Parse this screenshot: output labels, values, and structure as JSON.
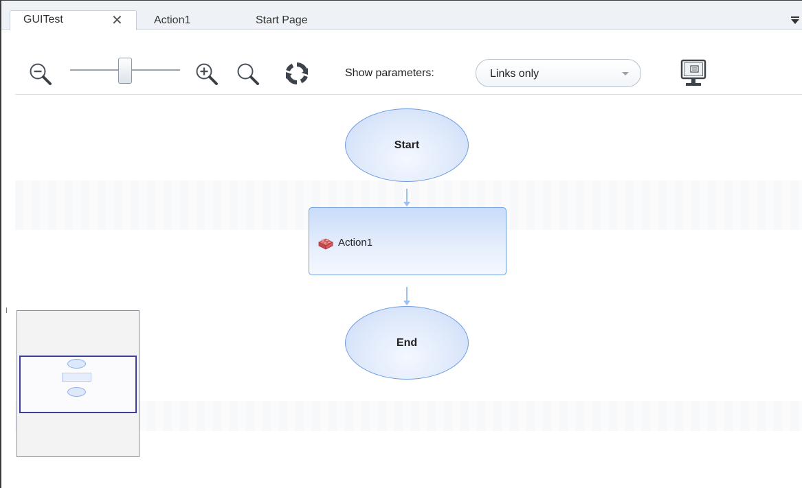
{
  "tabs": [
    {
      "label": "GUITest",
      "active": true,
      "closable": true
    },
    {
      "label": "Action1",
      "active": false
    },
    {
      "label": "Start Page",
      "active": false
    }
  ],
  "tab_close_glyph": "✕",
  "toolbar": {
    "show_parameters_label": "Show parameters:",
    "show_parameters_value": "Links only",
    "zoom_level": 0.45,
    "icons": [
      "zoom-out-icon",
      "zoom-in-icon",
      "zoom-fit-icon",
      "refresh-icon",
      "monitor-icon"
    ]
  },
  "flow": {
    "start_label": "Start",
    "action_label": "Action1",
    "end_label": "End"
  },
  "colors": {
    "node_border": "#6e9de0",
    "connector": "#9ec0ee",
    "minimap_viewport": "#3b3f9a",
    "action_icon": "#d9534f"
  }
}
